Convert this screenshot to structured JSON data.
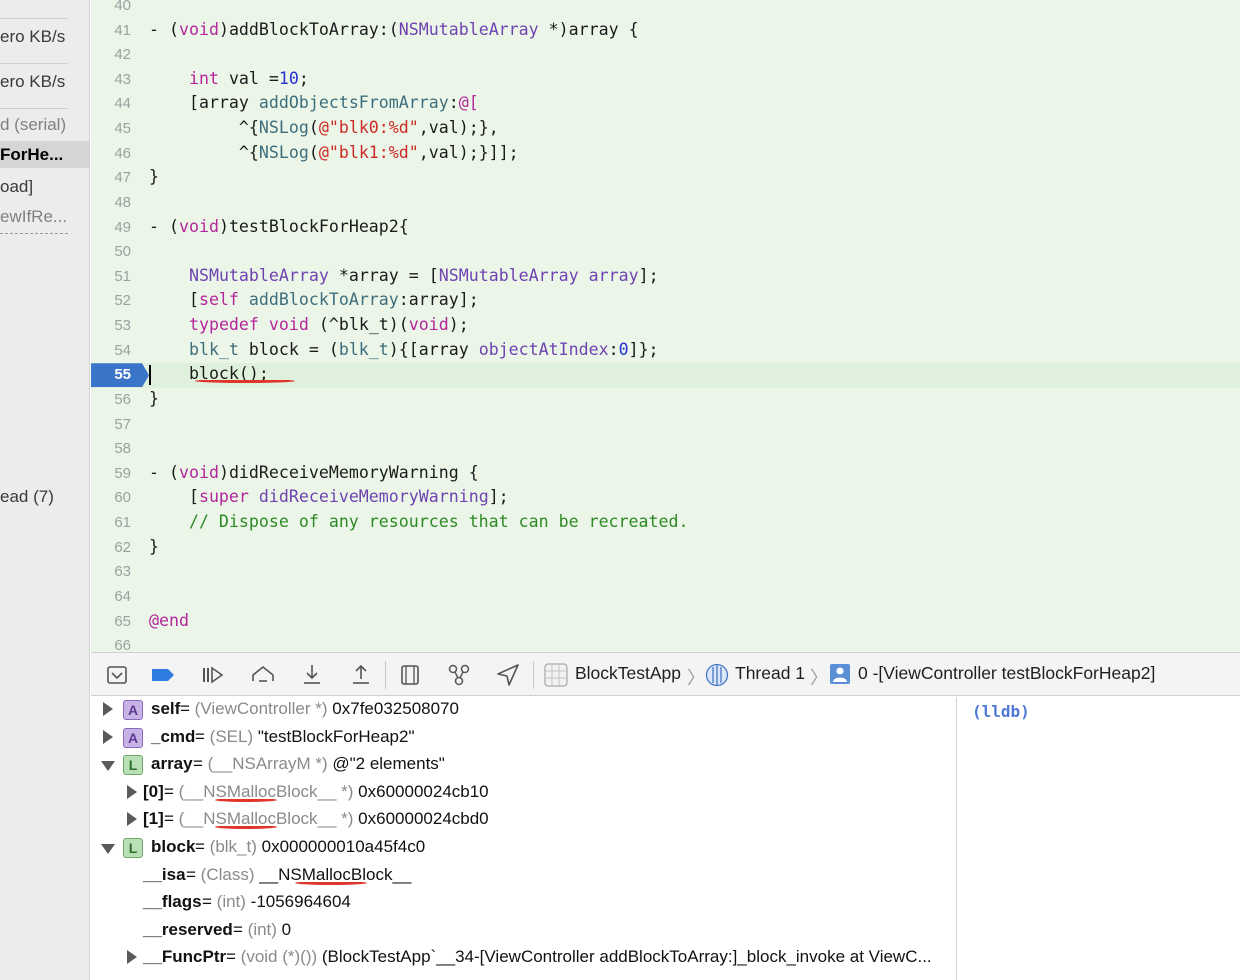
{
  "navigator": {
    "rows": [
      {
        "text": "ero KB/s",
        "style": "normal"
      },
      {
        "text": "ero KB/s",
        "style": "normal"
      },
      {
        "text": "d (serial)",
        "style": "dim"
      },
      {
        "text": "ForHe...",
        "style": "sel"
      },
      {
        "text": "oad]",
        "style": "normal"
      },
      {
        "text": "ewIfRe...",
        "style": "dim"
      },
      {
        "text": "ead (7)",
        "style": "normal"
      }
    ]
  },
  "editor": {
    "current_line": "55",
    "lines": [
      {
        "n": "40",
        "tokens": []
      },
      {
        "n": "41",
        "tokens": [
          [
            "",
            "- ("
          ],
          [
            "kw",
            "void"
          ],
          [
            "",
            ")addBlockToArray:("
          ],
          [
            "tp",
            "NSMutableArray"
          ],
          [
            "",
            " *)array {"
          ]
        ]
      },
      {
        "n": "42",
        "tokens": []
      },
      {
        "n": "43",
        "tokens": [
          [
            "",
            "    "
          ],
          [
            "kw",
            "int"
          ],
          [
            "",
            " val ="
          ],
          [
            "num",
            "10"
          ],
          [
            "",
            ";"
          ]
        ]
      },
      {
        "n": "44",
        "tokens": [
          [
            "",
            "    [array "
          ],
          [
            "mt",
            "addObjectsFromArray"
          ],
          [
            "",
            ":"
          ],
          [
            "at",
            "@["
          ]
        ]
      },
      {
        "n": "45",
        "tokens": [
          [
            "",
            "         ^{"
          ],
          [
            "mt",
            "NSLog"
          ],
          [
            "",
            "("
          ],
          [
            "str",
            "@\"blk0:%d\""
          ],
          [
            "",
            ",val);},"
          ]
        ]
      },
      {
        "n": "46",
        "tokens": [
          [
            "",
            "         ^{"
          ],
          [
            "mt",
            "NSLog"
          ],
          [
            "",
            "("
          ],
          [
            "str",
            "@\"blk1:%d\""
          ],
          [
            "",
            ",val);}]];"
          ]
        ]
      },
      {
        "n": "47",
        "tokens": [
          [
            "",
            "}"
          ]
        ]
      },
      {
        "n": "48",
        "tokens": []
      },
      {
        "n": "49",
        "tokens": [
          [
            "",
            "- ("
          ],
          [
            "kw",
            "void"
          ],
          [
            "",
            ")testBlockForHeap2{"
          ]
        ]
      },
      {
        "n": "50",
        "tokens": []
      },
      {
        "n": "51",
        "tokens": [
          [
            "",
            "    "
          ],
          [
            "tp",
            "NSMutableArray"
          ],
          [
            "",
            " *array = ["
          ],
          [
            "tp",
            "NSMutableArray"
          ],
          [
            "",
            " "
          ],
          [
            "tp",
            "array"
          ],
          [
            "",
            "];"
          ]
        ]
      },
      {
        "n": "52",
        "tokens": [
          [
            "",
            "    ["
          ],
          [
            "kw",
            "self"
          ],
          [
            "",
            " "
          ],
          [
            "mt",
            "addBlockToArray"
          ],
          [
            "",
            ":array];"
          ]
        ]
      },
      {
        "n": "53",
        "tokens": [
          [
            "",
            "    "
          ],
          [
            "kw",
            "typedef"
          ],
          [
            "",
            " "
          ],
          [
            "kw",
            "void"
          ],
          [
            "",
            " (^blk_t)("
          ],
          [
            "kw",
            "void"
          ],
          [
            "",
            ");"
          ]
        ]
      },
      {
        "n": "54",
        "tokens": [
          [
            "",
            "    "
          ],
          [
            "mt",
            "blk_t"
          ],
          [
            "",
            " block = ("
          ],
          [
            "mt",
            "blk_t"
          ],
          [
            "",
            "){[array "
          ],
          [
            "tp",
            "objectAtIndex"
          ],
          [
            "",
            ":"
          ],
          [
            "num",
            "0"
          ],
          [
            "",
            "]};"
          ]
        ]
      },
      {
        "n": "55",
        "tokens": [
          [
            "",
            "    block();"
          ]
        ]
      },
      {
        "n": "56",
        "tokens": [
          [
            "",
            "}"
          ]
        ]
      },
      {
        "n": "57",
        "tokens": []
      },
      {
        "n": "58",
        "tokens": []
      },
      {
        "n": "59",
        "tokens": [
          [
            "",
            "- ("
          ],
          [
            "kw",
            "void"
          ],
          [
            "",
            ")didReceiveMemoryWarning {"
          ]
        ]
      },
      {
        "n": "60",
        "tokens": [
          [
            "",
            "    ["
          ],
          [
            "kw",
            "super"
          ],
          [
            "",
            " "
          ],
          [
            "tp",
            "didReceiveMemoryWarning"
          ],
          [
            "",
            "];"
          ]
        ]
      },
      {
        "n": "61",
        "tokens": [
          [
            "cm",
            "    // Dispose of any resources that can be recreated."
          ]
        ]
      },
      {
        "n": "62",
        "tokens": [
          [
            "",
            "}"
          ]
        ]
      },
      {
        "n": "63",
        "tokens": []
      },
      {
        "n": "64",
        "tokens": []
      },
      {
        "n": "65",
        "tokens": [
          [
            "at",
            "@end"
          ]
        ]
      },
      {
        "n": "66",
        "tokens": []
      }
    ]
  },
  "debugbar": {
    "app": "BlockTestApp",
    "thread": "Thread 1",
    "frame": "0 -[ViewController testBlockForHeap2]",
    "icons": [
      "hide-debug-area-icon",
      "breakpoints-toggle-icon",
      "continue-icon",
      "step-over-icon",
      "step-into-icon",
      "step-out-icon",
      "view-hierarchy-icon",
      "memory-graph-icon",
      "simulate-location-icon"
    ]
  },
  "variables": [
    {
      "indent": 0,
      "tri": "r",
      "badge": "A",
      "name": "self",
      "type": "(ViewController *)",
      "value": " 0x7fe032508070"
    },
    {
      "indent": 0,
      "tri": "r",
      "badge": "A",
      "name": "_cmd",
      "type": "(SEL)",
      "value": " \"testBlockForHeap2\""
    },
    {
      "indent": 0,
      "tri": "d",
      "badge": "L",
      "name": "array",
      "type": "(__NSArrayM *)",
      "value": " @\"2 elements\""
    },
    {
      "indent": 1,
      "tri": "r",
      "badge": "",
      "name": "[0]",
      "type": "(__NSMallocBlock__ *)",
      "value": " 0x60000024cb10"
    },
    {
      "indent": 1,
      "tri": "r",
      "badge": "",
      "name": "[1]",
      "type": "(__NSMallocBlock__ *)",
      "value": " 0x60000024cbd0"
    },
    {
      "indent": 0,
      "tri": "d",
      "badge": "L",
      "name": "block",
      "type": "(blk_t)",
      "value": " 0x000000010a45f4c0"
    },
    {
      "indent": 1,
      "tri": "",
      "badge": "",
      "name": "__isa",
      "type": "(Class)",
      "value": " __NSMallocBlock__"
    },
    {
      "indent": 1,
      "tri": "",
      "badge": "",
      "name": "__flags",
      "type": "(int)",
      "value": " -1056964604"
    },
    {
      "indent": 1,
      "tri": "",
      "badge": "",
      "name": "__reserved",
      "type": "(int)",
      "value": " 0"
    },
    {
      "indent": 1,
      "tri": "r",
      "badge": "",
      "name": "__FuncPtr",
      "type": "(void (*)())",
      "value": " (BlockTestApp`__34-[ViewController addBlockToArray:]_block_invoke at ViewC..."
    }
  ],
  "console": {
    "prompt": "(lldb)"
  }
}
